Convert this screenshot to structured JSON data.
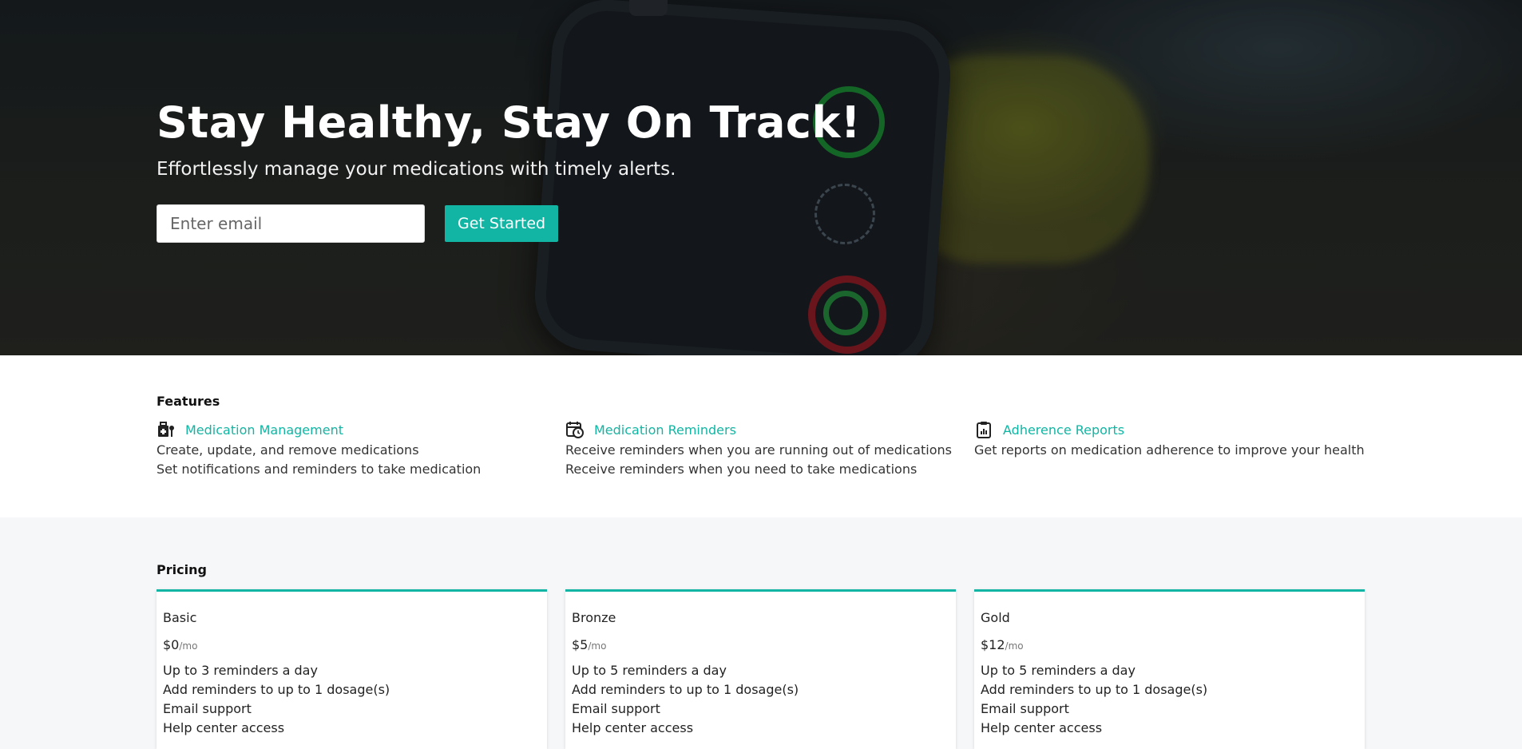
{
  "hero": {
    "title": "Stay Healthy, Stay On Track!",
    "subtitle": "Effortlessly manage your medications with timely alerts.",
    "email_placeholder": "Enter email",
    "cta_label": "Get Started"
  },
  "features": {
    "heading": "Features",
    "items": [
      {
        "icon": "medication-bag-icon",
        "title": "Medication Management",
        "lines": [
          "Create, update, and remove medications",
          "Set notifications and reminders to take medication"
        ]
      },
      {
        "icon": "calendar-clock-icon",
        "title": "Medication Reminders",
        "lines": [
          "Receive reminders when you are running out of medications",
          "Receive reminders when you need to take medications"
        ]
      },
      {
        "icon": "clipboard-icon",
        "title": "Adherence Reports",
        "lines": [
          "Get reports on medication adherence to improve your health"
        ]
      }
    ]
  },
  "pricing": {
    "heading": "Pricing",
    "plans": [
      {
        "name": "Basic",
        "price": "$0",
        "period": "/mo",
        "features": [
          "Up to 3 reminders a day",
          "Add reminders to up to 1 dosage(s)",
          "Email support",
          "Help center access"
        ]
      },
      {
        "name": "Bronze",
        "price": "$5",
        "period": "/mo",
        "features": [
          "Up to 5 reminders a day",
          "Add reminders to up to 1 dosage(s)",
          "Email support",
          "Help center access"
        ]
      },
      {
        "name": "Gold",
        "price": "$12",
        "period": "/mo",
        "features": [
          "Up to 5 reminders a day",
          "Add reminders to up to 1 dosage(s)",
          "Email support",
          "Help center access"
        ]
      }
    ]
  },
  "colors": {
    "accent": "#12b5a3",
    "hero_overlay": "#000000",
    "pricing_background": "#f6f7f9"
  }
}
